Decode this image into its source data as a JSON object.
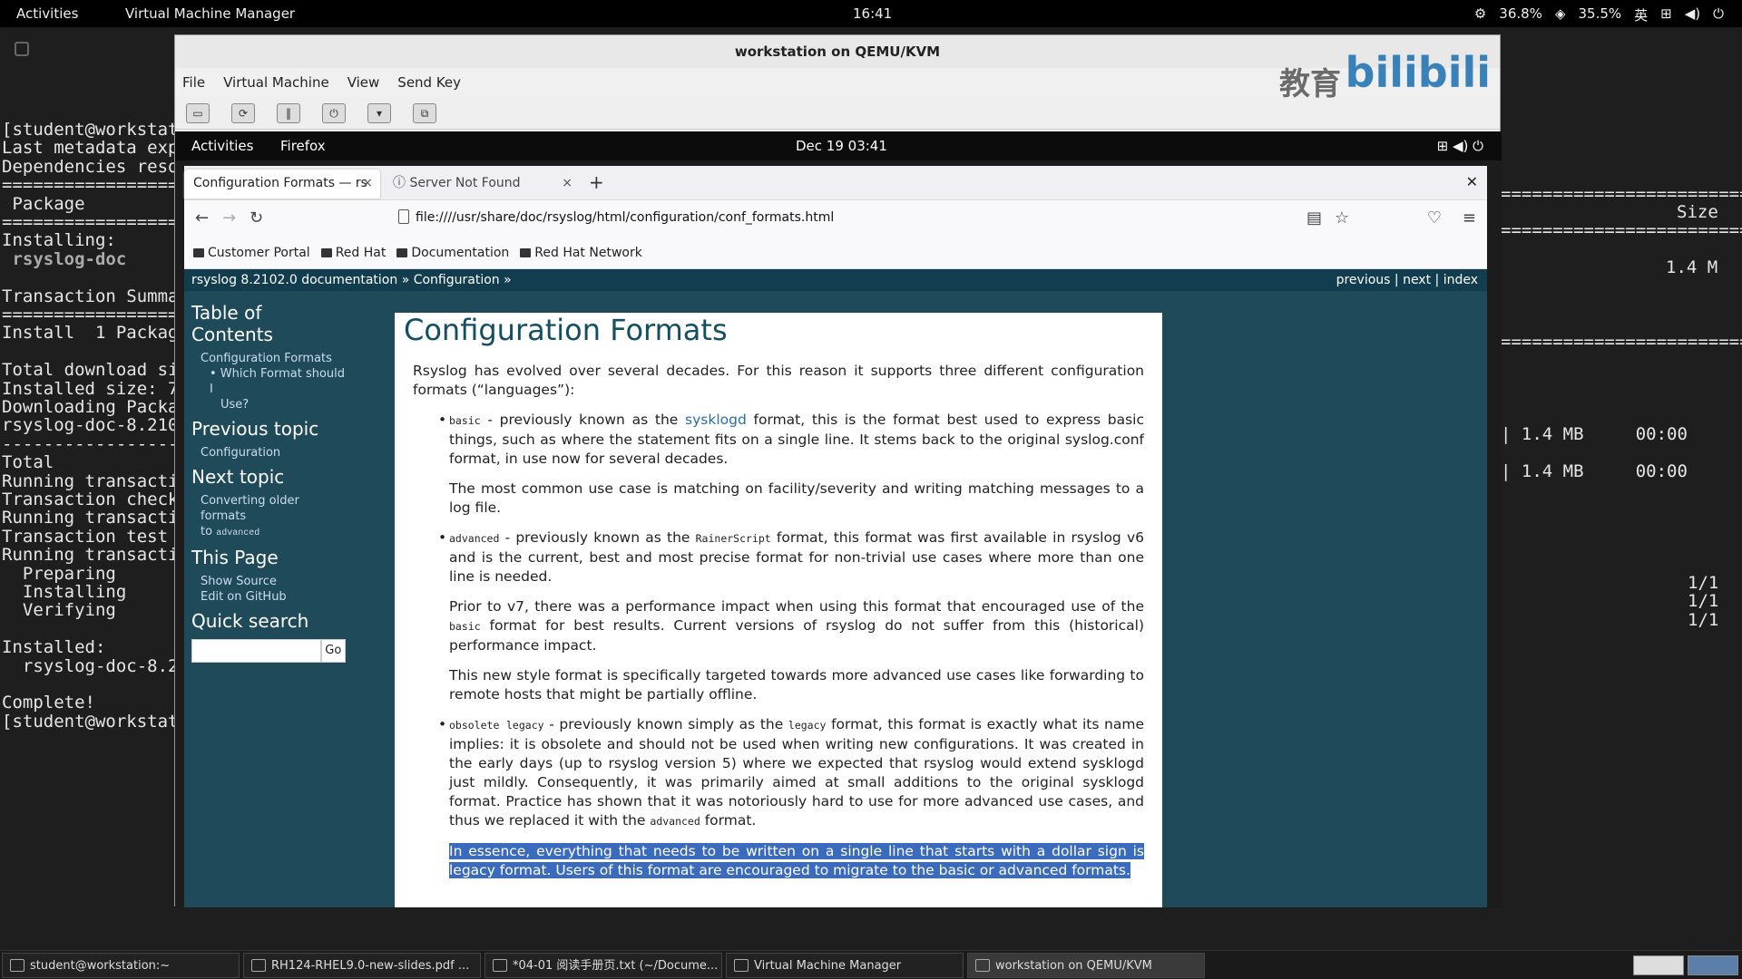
{
  "host_top": {
    "activities": "Activities",
    "app_name": "Virtual Machine Manager",
    "clock": "16:41",
    "cpu": "36.8%",
    "mem": "35.5%",
    "ime": "英"
  },
  "terminal": {
    "lines_left": [
      "[student@workstat",
      "Last metadata exp",
      "Dependencies reso",
      "==================",
      " Package",
      "==================",
      "Installing:",
      " rsyslog-doc",
      "",
      "Transaction Summa",
      "==================",
      "Install  1 Packag",
      "",
      "Total download si",
      "Installed size: 7",
      "Downloading Packa",
      "rsyslog-doc-8.210",
      "------------------",
      "Total",
      "Running transacti",
      "Transaction check",
      "Running transacti",
      "Transaction test s",
      "Running transacti",
      "  Preparing",
      "  Installing",
      "  Verifying",
      "",
      "Installed:",
      "  rsyslog-doc-8.2",
      "",
      "Complete!",
      "[student@workstat"
    ],
    "right": {
      "size_header": "Size",
      "size_value": "1.4 M",
      "dl1": "| 1.4 MB     00:00",
      "dl2": "| 1.4 MB     00:00",
      "p1": "1/1",
      "p2": "1/1",
      "p3": "1/1",
      "sep": "=========================="
    }
  },
  "vm": {
    "title": "workstation on QEMU/KVM",
    "menu": [
      "File",
      "Virtual Machine",
      "View",
      "Send Key"
    ],
    "logo_text": "bilibili",
    "logo_cn": "教育"
  },
  "guest_top": {
    "activities": "Activities",
    "app": "Firefox",
    "clock": "Dec 19  03:41"
  },
  "firefox": {
    "tab_active": "Configuration Formats — rs",
    "tab_other": "Server Not Found",
    "url": "file:////usr/share/doc/rsyslog/html/configuration/conf_formats.html",
    "bookmarks": [
      "Customer Portal",
      "Red Hat",
      "Documentation",
      "Red Hat Network"
    ]
  },
  "doc": {
    "breadcrumb": "rsyslog 8.2102.0 documentation » Configuration »",
    "nav": "previous | next | index",
    "toc_title": "Table of Contents",
    "toc_1": "Configuration Formats",
    "toc_2a": "• Which Format should I",
    "toc_2b": "Use?",
    "prev_title": "Previous topic",
    "prev_link": "Configuration",
    "next_title": "Next topic",
    "next_link_a": "Converting older formats",
    "next_link_b": "to",
    "next_code": "advanced",
    "this_title": "This Page",
    "show_source": "Show Source",
    "edit_github": "Edit on GitHub",
    "search_title": "Quick search",
    "go": "Go",
    "h1": "Configuration Formats",
    "intro": "Rsyslog has evolved over several decades. For this reason it supports three different configuration formats (“languages”):",
    "b1_code": "basic",
    "b1_a": " - previously known as the ",
    "b1_link": "sysklogd",
    "b1_b": " format, this is the format best used to express basic things, such as where the statement fits on a single line. It stems back to the original syslog.conf format, in use now for several decades.",
    "b1_p2": "The most common use case is matching on facility/severity and writing matching messages to a log file.",
    "b2_code": "advanced",
    "b2_a": " - previously known as the ",
    "b2_code2": "RainerScript",
    "b2_b": " format, this format was first available in rsyslog v6 and is the current, best and most precise format for non-trivial use cases where more than one line is needed.",
    "b2_p2a": "Prior to v7, there was a performance impact when using this format that encouraged use of the ",
    "b2_p2code": "basic",
    "b2_p2b": " format for best results. Current versions of rsyslog do not suffer from this (historical) performance impact.",
    "b2_p3": "This new style format is specifically targeted towards more advanced use cases like forwarding to remote hosts that might be partially offline.",
    "b3_code": "obsolete legacy",
    "b3_a": " - previously known simply as the ",
    "b3_code2": "legacy",
    "b3_b": " format, this format is exactly what its name implies: it is obsolete and should not be used when writing new configurations. It was created in the early days (up to rsyslog version 5) where we expected that rsyslog would extend sysklogd just mildly. Consequently, it was primarily aimed at small additions to the original sysklogd format. Practice has shown that it was notoriously hard to use for more advanced use cases, and thus we replaced it with the ",
    "b3_code3": "advanced",
    "b3_c": " format.",
    "highlight": "In essence, everything that needs to be written on a single line that starts with a dollar sign is legacy format. Users of this format are encouraged to migrate to the basic or advanced formats."
  },
  "taskbar": {
    "t1": "student@workstation:~",
    "t2": "RH124-RHEL9.0-new-slides.pdf ...",
    "t3": "*04-01 阅读手册页.txt (~/Docume...",
    "t4": "Virtual Machine Manager",
    "t5": "workstation on QEMU/KVM"
  }
}
